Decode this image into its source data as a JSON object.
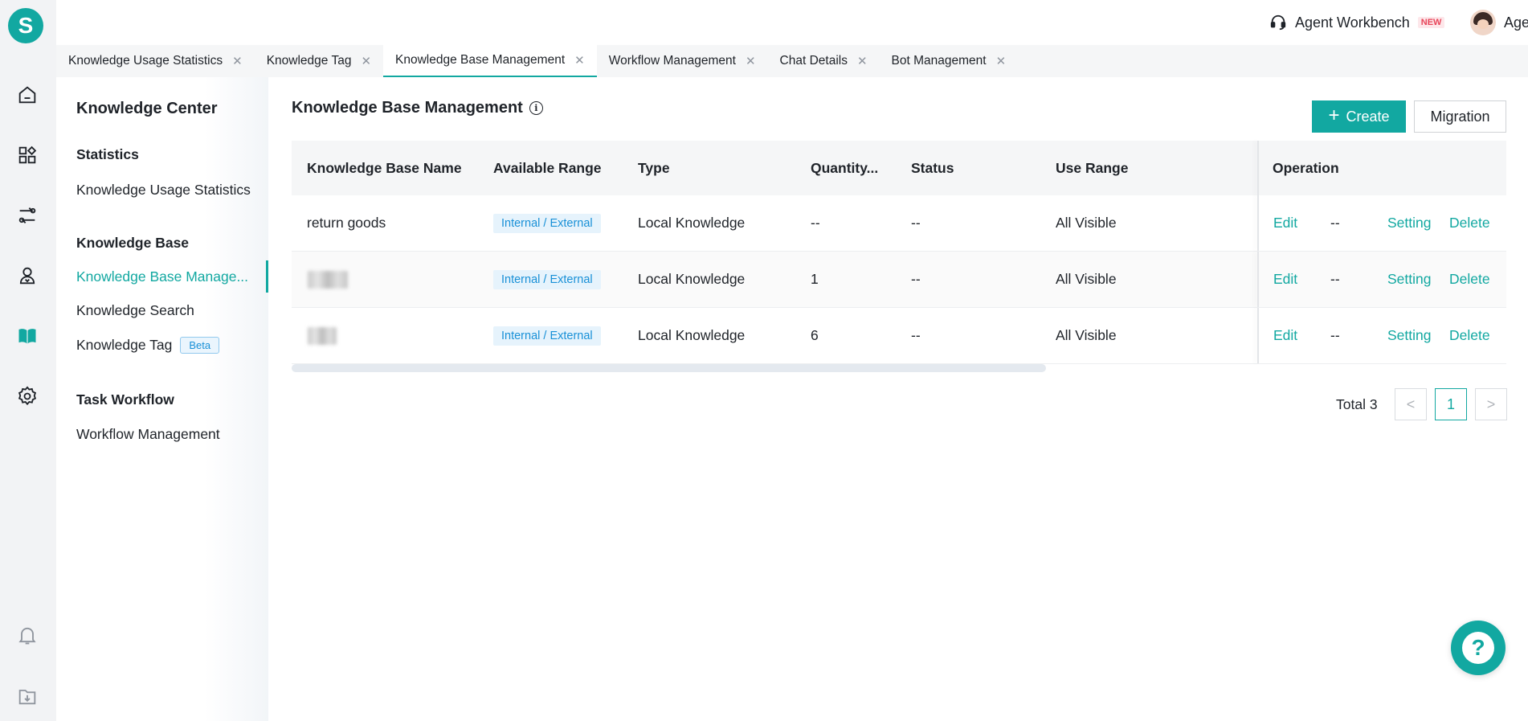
{
  "app": {
    "logo_letter": "S",
    "accent_color": "#12a8a1"
  },
  "header": {
    "workbench_label": "Agent Workbench",
    "workbench_badge": "NEW",
    "user_name": "Agent"
  },
  "rail": {
    "icons": [
      "home-icon",
      "apps-icon",
      "flow-icon",
      "bot-icon",
      "knowledge-book-icon",
      "settings-icon",
      "bell-icon",
      "download-icon"
    ],
    "active_icon": "knowledge-book-icon"
  },
  "tabs": [
    {
      "label": "Knowledge Usage Statistics",
      "active": false
    },
    {
      "label": "Knowledge Tag",
      "active": false
    },
    {
      "label": "Knowledge Base Management",
      "active": true
    },
    {
      "label": "Workflow Management",
      "active": false
    },
    {
      "label": "Chat Details",
      "active": false
    },
    {
      "label": "Bot Management",
      "active": false
    }
  ],
  "tab_close_glyph": "✕",
  "sidebar": {
    "title": "Knowledge Center",
    "groups": [
      {
        "label": "Statistics",
        "items": [
          "Knowledge Usage Statistics"
        ]
      },
      {
        "label": "Knowledge Base",
        "items": [
          "Knowledge Base Manage...",
          "Knowledge Search",
          "Knowledge Tag"
        ]
      },
      {
        "label": "Task Workflow",
        "items": [
          "Workflow Management"
        ]
      }
    ],
    "active_item": "Knowledge Base Manage...",
    "beta_badge": "Beta"
  },
  "main": {
    "title": "Knowledge Base Management",
    "create_label": "Create",
    "migration_label": "Migration",
    "columns": [
      "Knowledge Base Name",
      "Available Range",
      "Type",
      "Quantity...",
      "Status",
      "Use Range",
      "Operation"
    ],
    "rows": [
      {
        "name": "return goods",
        "name_redacted": false,
        "range": "Internal / External",
        "type": "Local Knowledge",
        "quantity": "--",
        "status": "--",
        "use_range": "All Visible",
        "ops": [
          "Edit",
          "--",
          "Setting",
          "Delete"
        ]
      },
      {
        "name": "",
        "name_redacted": true,
        "range": "Internal / External",
        "type": "Local Knowledge",
        "quantity": "1",
        "status": "--",
        "use_range": "All Visible",
        "ops": [
          "Edit",
          "--",
          "Setting",
          "Delete"
        ]
      },
      {
        "name": "",
        "name_redacted": true,
        "range": "Internal / External",
        "type": "Local Knowledge",
        "quantity": "6",
        "status": "--",
        "use_range": "All Visible",
        "ops": [
          "Edit",
          "--",
          "Setting",
          "Delete"
        ]
      }
    ],
    "pagination": {
      "total_label": "Total 3",
      "current_page": "1",
      "prev_glyph": "<",
      "next_glyph": ">"
    }
  },
  "help_glyph": "?"
}
